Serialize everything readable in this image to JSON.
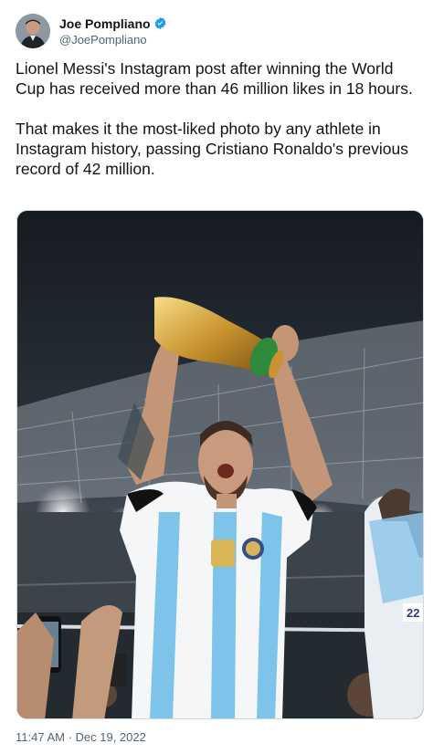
{
  "author": {
    "display_name": "Joe Pompliano",
    "handle": "@JoePompliano",
    "verified": true,
    "verified_icon": "verified-badge-icon",
    "verified_color": "#1d9bf0"
  },
  "tweet": {
    "paragraphs": [
      "Lionel Messi's Instagram post after winning the World Cup has received more than 46 million likes in 18 hours.",
      "That makes it the most-liked photo by any athlete in Instagram history, passing Cristiano Ronaldo's previous record of 42 million."
    ],
    "timestamp": "11:47 AM · Dec 19, 2022"
  },
  "media": {
    "jersey_number": "22"
  },
  "colors": {
    "text_primary": "#0f1419",
    "text_secondary": "#536471",
    "border": "#cfd9de"
  }
}
